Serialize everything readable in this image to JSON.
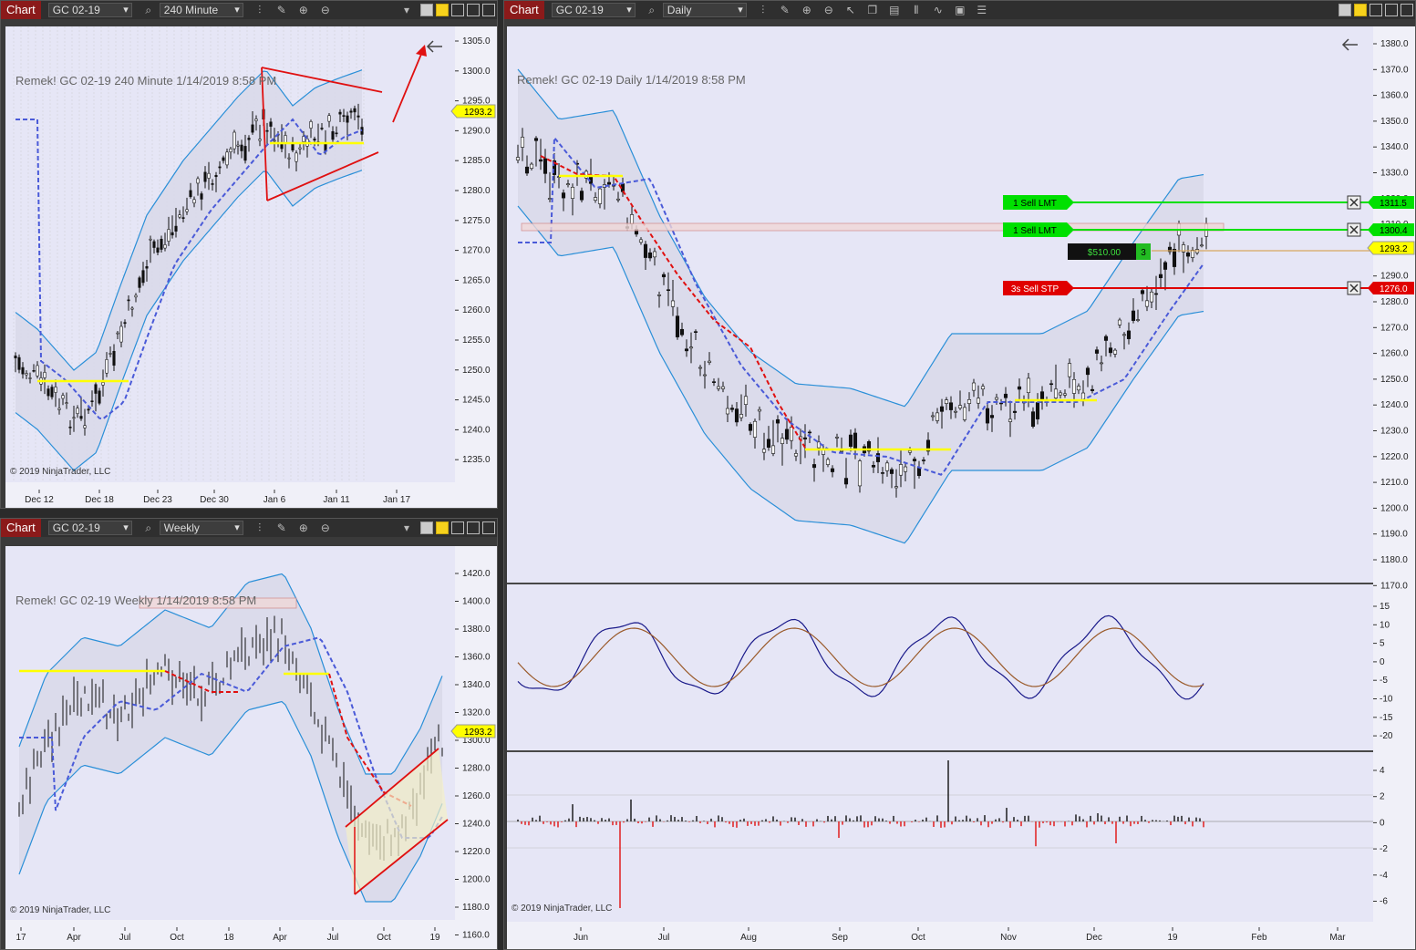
{
  "app": {
    "chart_tab": "Chart",
    "instrument": "GC 02-19",
    "copyright": "© 2019 NinjaTrader, LLC"
  },
  "windows": [
    {
      "id": "w240",
      "interval": "240 Minute",
      "title": "Remek!  GC 02-19  240 Minute  1/14/2019 8:58 PM",
      "price_ticks": [
        "1305.0",
        "1300.0",
        "1295.0",
        "1290.0",
        "1285.0",
        "1280.0",
        "1275.0",
        "1270.0",
        "1265.0",
        "1260.0",
        "1255.0",
        "1250.0",
        "1245.0",
        "1240.0",
        "1235.0"
      ],
      "date_ticks": [
        "Dec 12",
        "Dec 18",
        "Dec 23",
        "Dec 30",
        "Jan 6",
        "Jan 11",
        "Jan 17"
      ],
      "last_price": "1293.2"
    },
    {
      "id": "wweek",
      "interval": "Weekly",
      "title": "Remek!  GC 02-19  Weekly  1/14/2019 8:58 PM",
      "price_ticks": [
        "1420.0",
        "1400.0",
        "1380.0",
        "1360.0",
        "1340.0",
        "1320.0",
        "1300.0",
        "1280.0",
        "1260.0",
        "1240.0",
        "1220.0",
        "1200.0",
        "1180.0",
        "1160.0"
      ],
      "date_ticks": [
        "17",
        "Apr",
        "Jul",
        "Oct",
        "18",
        "Apr",
        "Jul",
        "Oct",
        "19"
      ],
      "last_price": "1293.2"
    },
    {
      "id": "wday",
      "interval": "Daily",
      "title": "Remek!  GC 02-19  Daily  1/14/2019 8:58 PM",
      "price_ticks": [
        "1380.0",
        "1370.0",
        "1360.0",
        "1350.0",
        "1340.0",
        "1330.0",
        "1320.0",
        "1310.0",
        "1300.0",
        "1290.0",
        "1280.0",
        "1270.0",
        "1260.0",
        "1250.0",
        "1240.0",
        "1230.0",
        "1220.0",
        "1210.0",
        "1200.0",
        "1190.0",
        "1180.0",
        "1170.0"
      ],
      "osc_ticks": [
        "15",
        "10",
        "5",
        "0",
        "-5",
        "-10",
        "-15",
        "-20"
      ],
      "hist_ticks": [
        "4",
        "2",
        "0",
        "-2",
        "-4",
        "-6"
      ],
      "date_ticks": [
        "Jun",
        "Jul",
        "Aug",
        "Sep",
        "Oct",
        "Nov",
        "Dec",
        "19",
        "Feb",
        "Mar"
      ],
      "last_price": "1293.2",
      "orders": [
        {
          "label": "1  Sell LMT",
          "price": "1311.5",
          "color": "#00e000"
        },
        {
          "label": "1  Sell LMT",
          "price": "1300.4",
          "color": "#00e000"
        },
        {
          "label": "3s  Sell STP",
          "price": "1276.0",
          "color": "#e00000"
        }
      ],
      "position": {
        "pnl": "$510.00",
        "qty": "3"
      }
    }
  ]
}
